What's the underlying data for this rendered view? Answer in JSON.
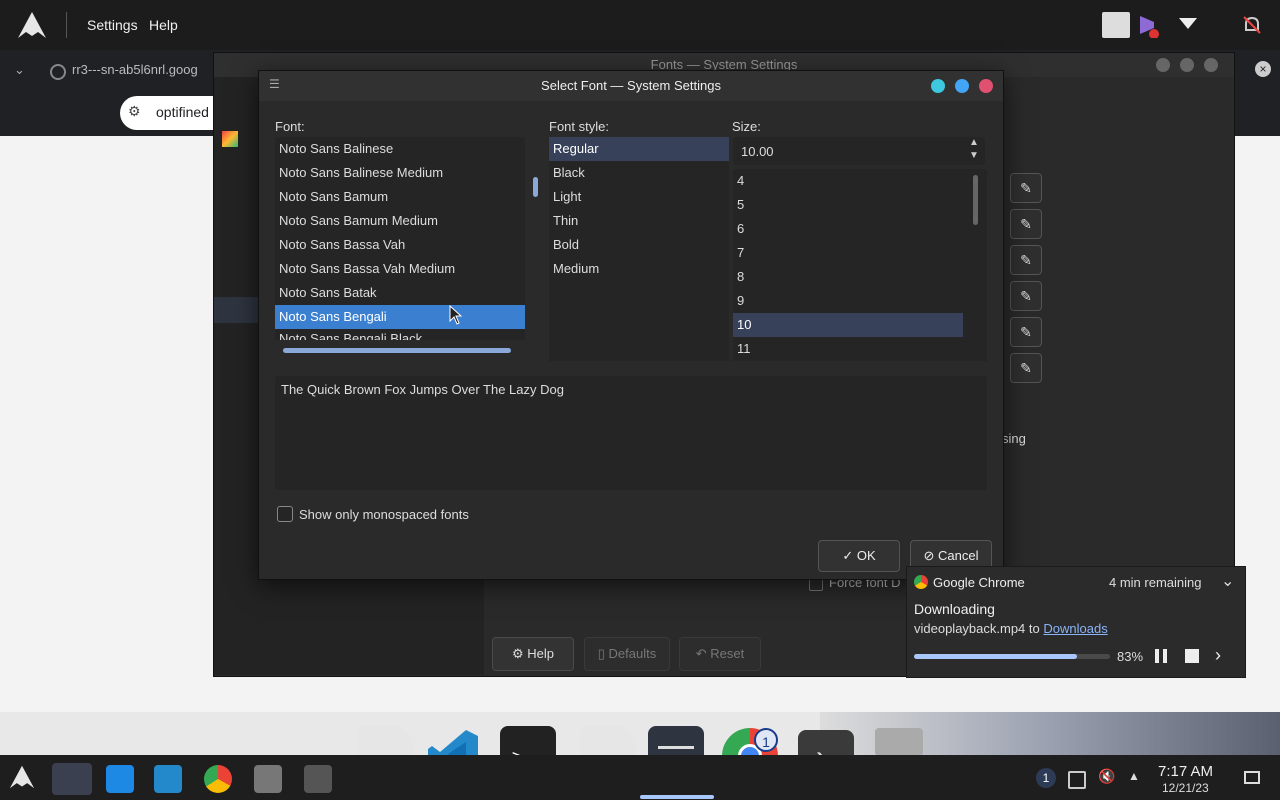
{
  "topbar": {
    "menu": [
      "Settings",
      "Help"
    ]
  },
  "chrome": {
    "tab_url": "rr3---sn-ab5l6nrl.goog",
    "omnibox_text": "optifined"
  },
  "sysset": {
    "title": "Fonts — System Settings",
    "partial_text_using": "sing",
    "partial_text_force": "Force font D",
    "help_label": "Help",
    "defaults_label": "Defaults",
    "reset_label": "Reset"
  },
  "dialog": {
    "title": "Select Font — System Settings",
    "font_label": "Font:",
    "style_label": "Font style:",
    "size_label": "Size:",
    "fonts": [
      "Noto Sans Balinese",
      "Noto Sans Balinese Medium",
      "Noto Sans Bamum",
      "Noto Sans Bamum Medium",
      "Noto Sans Bassa Vah",
      "Noto Sans Bassa Vah Medium",
      "Noto Sans Batak",
      "Noto Sans Bengali",
      "Noto Sans Bengali Black"
    ],
    "selected_font": "Noto Sans Bengali",
    "styles": [
      "Regular",
      "Black",
      "Light",
      "Thin",
      "Bold",
      "Medium"
    ],
    "selected_style": "Regular",
    "size_value": "10.00",
    "sizes": [
      "4",
      "5",
      "6",
      "7",
      "8",
      "9",
      "10",
      "11"
    ],
    "selected_size": "10",
    "preview_text": "The Quick Brown Fox Jumps Over The Lazy Dog",
    "monospace_label": "Show only monospaced fonts",
    "ok_label": "OK",
    "cancel_label": "Cancel"
  },
  "notification": {
    "app": "Google Chrome",
    "remaining": "4 min remaining",
    "heading": "Downloading",
    "file": "videoplayback.mp4",
    "to_word": "to",
    "folder_link": "Downloads",
    "progress_percent": 83,
    "progress_label": "83%"
  },
  "taskbar": {
    "time": "7:17 AM",
    "date": "12/21/23",
    "chrome_badge": "1",
    "tray_badge": "1"
  },
  "colors": {
    "accent": "#3b7fd0",
    "progress": "#a8c7fa",
    "link": "#8ab4f8"
  }
}
